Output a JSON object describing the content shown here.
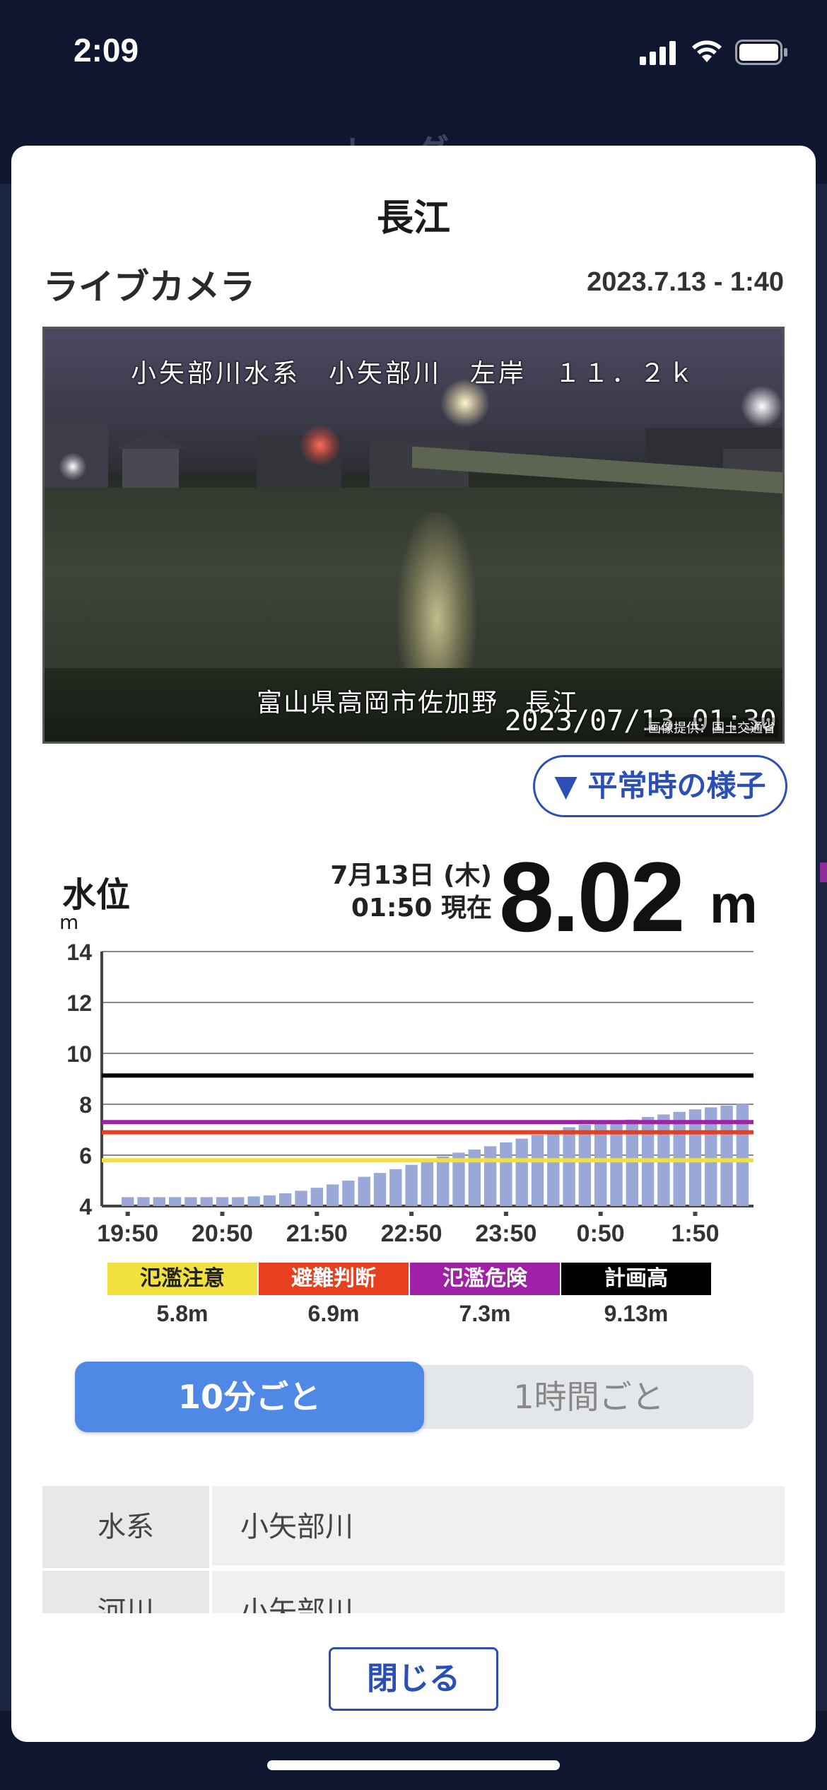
{
  "status_bar": {
    "time": "2:09",
    "icons": [
      "cellular-signal-icon",
      "wifi-icon",
      "battery-icon"
    ]
  },
  "backdrop": {
    "title": "レーダー"
  },
  "sheet": {
    "title": "長江",
    "camera": {
      "section_title": "ライブカメラ",
      "date": "2023.7.13 - 1:40",
      "caption_top": "小矢部川水系　小矢部川　左岸　１１．２ｋ",
      "caption_bottom": "富山県高岡市佐加野　長江",
      "timestamp": "2023/07/13 01:30",
      "credit": "画像提供：国土交通省",
      "normal_button": "▼ 平常時の様子"
    },
    "water_level": {
      "title": "水位",
      "unit": "m",
      "date_line1": "7月13日 (木)",
      "date_line2": "01:50 現在",
      "value": "8.02",
      "value_unit": "m"
    },
    "legend": [
      {
        "label": "氾濫注意",
        "value": "5.8m",
        "color": "#f0e040",
        "text_color": "#222"
      },
      {
        "label": "避難判断",
        "value": "6.9m",
        "color": "#e8401e",
        "text_color": "#fff"
      },
      {
        "label": "氾濫危険",
        "value": "7.3m",
        "color": "#a020a8",
        "text_color": "#fff"
      },
      {
        "label": "計画高",
        "value": "9.13m",
        "color": "#000000",
        "text_color": "#fff"
      }
    ],
    "segment": {
      "active": "10分ごと",
      "inactive": "1時間ごと"
    },
    "info": [
      {
        "head": "水系",
        "value": "小矢部川"
      },
      {
        "head": "河川",
        "value": "小矢部川"
      }
    ],
    "close_button": "閉じる"
  },
  "chart_data": {
    "type": "bar",
    "ylabel": "m",
    "ylim": [
      4,
      14
    ],
    "yticks": [
      4,
      6,
      8,
      10,
      12,
      14
    ],
    "xtick_labels": [
      "19:50",
      "20:50",
      "21:50",
      "22:50",
      "23:50",
      "0:50",
      "1:50"
    ],
    "bar_color": "#9aa8d8",
    "values": [
      4.35,
      4.35,
      4.35,
      4.35,
      4.35,
      4.35,
      4.35,
      4.35,
      4.38,
      4.42,
      4.5,
      4.6,
      4.72,
      4.85,
      5.0,
      5.15,
      5.3,
      5.45,
      5.62,
      5.8,
      5.95,
      6.1,
      6.22,
      6.35,
      6.5,
      6.65,
      6.8,
      6.95,
      7.1,
      7.2,
      7.3,
      7.35,
      7.4,
      7.5,
      7.6,
      7.7,
      7.8,
      7.88,
      7.95,
      8.02
    ],
    "threshold_lines": [
      {
        "name": "氾濫注意",
        "value": 5.8,
        "color": "#f0e040"
      },
      {
        "name": "避難判断",
        "value": 6.9,
        "color": "#e8401e"
      },
      {
        "name": "氾濫危険",
        "value": 7.3,
        "color": "#a020a8"
      },
      {
        "name": "計画高",
        "value": 9.13,
        "color": "#000000"
      }
    ],
    "grid": true
  }
}
